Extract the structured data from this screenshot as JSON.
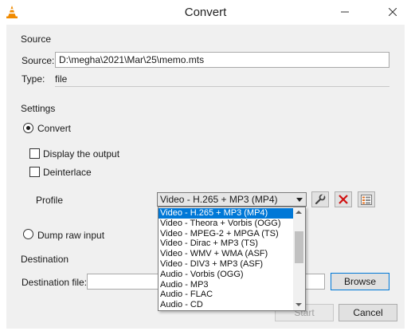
{
  "window": {
    "title": "Convert",
    "minimize_icon": "minimize-icon",
    "maximize_icon": "maximize-icon",
    "close_icon": "close-icon"
  },
  "source": {
    "group_label": "Source",
    "source_label": "Source:",
    "source_value": "D:\\megha\\2021\\Mar\\25\\memo.mts",
    "type_label": "Type:",
    "type_value": "file"
  },
  "settings": {
    "group_label": "Settings",
    "convert_label": "Convert",
    "convert_checked": true,
    "display_output_label": "Display the output",
    "display_output_checked": false,
    "deinterlace_label": "Deinterlace",
    "deinterlace_checked": false,
    "profile_label": "Profile",
    "profile_selected": "Video - H.265 + MP3 (MP4)",
    "dump_raw_label": "Dump raw input",
    "dump_raw_checked": false
  },
  "profile_dropdown": {
    "options": [
      "Video - H.265 + MP3 (MP4)",
      "Video - Theora + Vorbis (OGG)",
      "Video - MPEG-2 + MPGA (TS)",
      "Video - Dirac + MP3 (TS)",
      "Video - WMV + WMA (ASF)",
      "Video - DIV3 + MP3 (ASF)",
      "Audio - Vorbis (OGG)",
      "Audio - MP3",
      "Audio - FLAC",
      "Audio - CD"
    ],
    "selected_index": 0
  },
  "destination": {
    "group_label": "Destination",
    "file_label": "Destination file:",
    "file_value": "",
    "browse_label": "Browse"
  },
  "footer": {
    "start_label": "Start",
    "cancel_label": "Cancel"
  },
  "colors": {
    "accent": "#0078d7",
    "delete_red": "#d01010",
    "vlc_orange": "#f08a00"
  }
}
